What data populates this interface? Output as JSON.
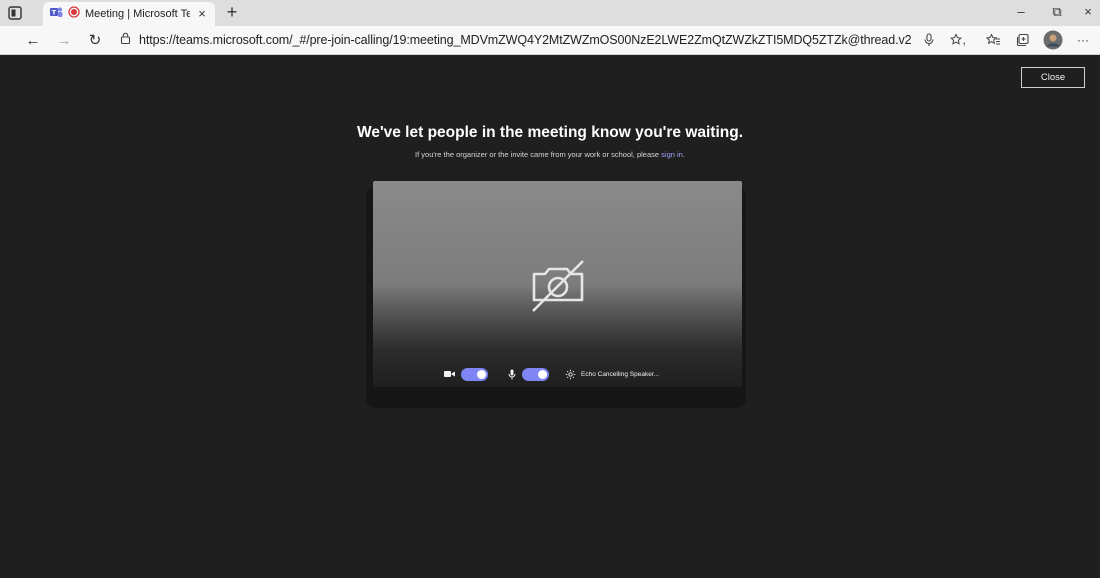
{
  "browser": {
    "tab": {
      "title": "Meeting | Microsoft Teams",
      "close": "×"
    },
    "new_tab": "+",
    "window": {
      "minimize": "–",
      "maximize": "⧉",
      "close": "×"
    },
    "nav": {
      "back": "←",
      "forward": "→",
      "refresh": "↻"
    },
    "url": "https://teams.microsoft.com/_#/pre-join-calling/19:meeting_MDVmZWQ4Y2MtZWZmOS00NzE2LWE2ZmQtZWZkZTI5MDQ5ZTZk@thread.v2",
    "menu": "···"
  },
  "page": {
    "close_button": "Close",
    "heading": "We've let people in the meeting know you're waiting.",
    "subtext_before": "If you're the organizer or the invite came from your work or school, please ",
    "subtext_link": "sign in",
    "subtext_after": ".",
    "device_label": "Echo Cancelling Speaker...",
    "camera_on": true,
    "mic_on": true,
    "accent_color": "#7f85f5"
  }
}
